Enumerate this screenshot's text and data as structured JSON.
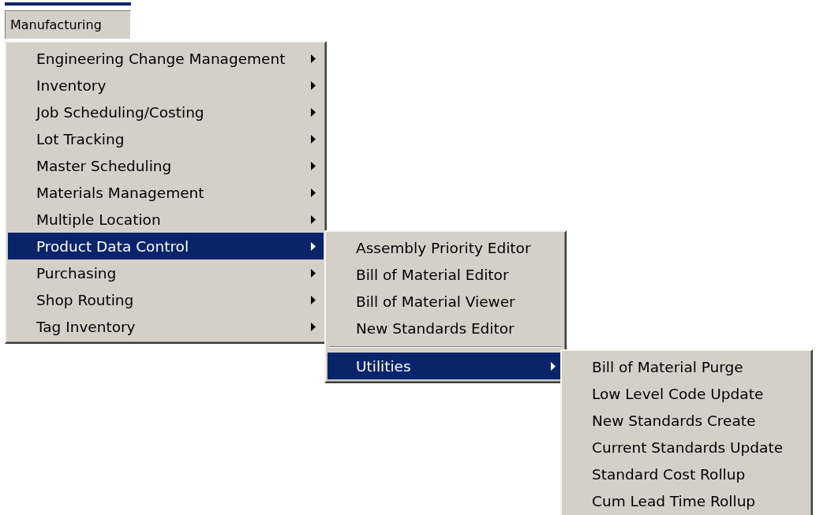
{
  "menu_bar": {
    "label": "Manufacturing",
    "selected": true
  },
  "menu": [
    {
      "kind": "item",
      "label": "Engineering Change Management",
      "has_submenu": true,
      "selected": false
    },
    {
      "kind": "item",
      "label": "Inventory",
      "has_submenu": true,
      "selected": false
    },
    {
      "kind": "item",
      "label": "Job Scheduling/Costing",
      "has_submenu": true,
      "selected": false
    },
    {
      "kind": "item",
      "label": "Lot Tracking",
      "has_submenu": true,
      "selected": false
    },
    {
      "kind": "item",
      "label": "Master Scheduling",
      "has_submenu": true,
      "selected": false
    },
    {
      "kind": "item",
      "label": "Materials Management",
      "has_submenu": true,
      "selected": false
    },
    {
      "kind": "item",
      "label": "Multiple Location",
      "has_submenu": true,
      "selected": false
    },
    {
      "kind": "item",
      "label": "Product Data Control",
      "has_submenu": true,
      "selected": true,
      "children": [
        {
          "kind": "item",
          "label": "Assembly Priority Editor",
          "has_submenu": false,
          "selected": false
        },
        {
          "kind": "item",
          "label": "Bill of Material Editor",
          "has_submenu": false,
          "selected": false
        },
        {
          "kind": "item",
          "label": "Bill of Material Viewer",
          "has_submenu": false,
          "selected": false
        },
        {
          "kind": "item",
          "label": "New Standards Editor",
          "has_submenu": false,
          "selected": false
        },
        {
          "kind": "separator"
        },
        {
          "kind": "item",
          "label": "Utilities",
          "has_submenu": true,
          "selected": true,
          "children": [
            {
              "kind": "item",
              "label": "Bill of Material Purge",
              "has_submenu": false,
              "selected": false
            },
            {
              "kind": "item",
              "label": "Low Level Code Update",
              "has_submenu": false,
              "selected": false
            },
            {
              "kind": "item",
              "label": "New Standards Create",
              "has_submenu": false,
              "selected": false
            },
            {
              "kind": "item",
              "label": "Current Standards Update",
              "has_submenu": false,
              "selected": false
            },
            {
              "kind": "item",
              "label": "Standard Cost Rollup",
              "has_submenu": false,
              "selected": false
            },
            {
              "kind": "item",
              "label": "Cum Lead Time Rollup",
              "has_submenu": false,
              "selected": false
            }
          ]
        }
      ]
    },
    {
      "kind": "item",
      "label": "Purchasing",
      "has_submenu": true,
      "selected": false
    },
    {
      "kind": "item",
      "label": "Shop Routing",
      "has_submenu": true,
      "selected": false
    },
    {
      "kind": "item",
      "label": "Tag Inventory",
      "has_submenu": true,
      "selected": false
    }
  ]
}
